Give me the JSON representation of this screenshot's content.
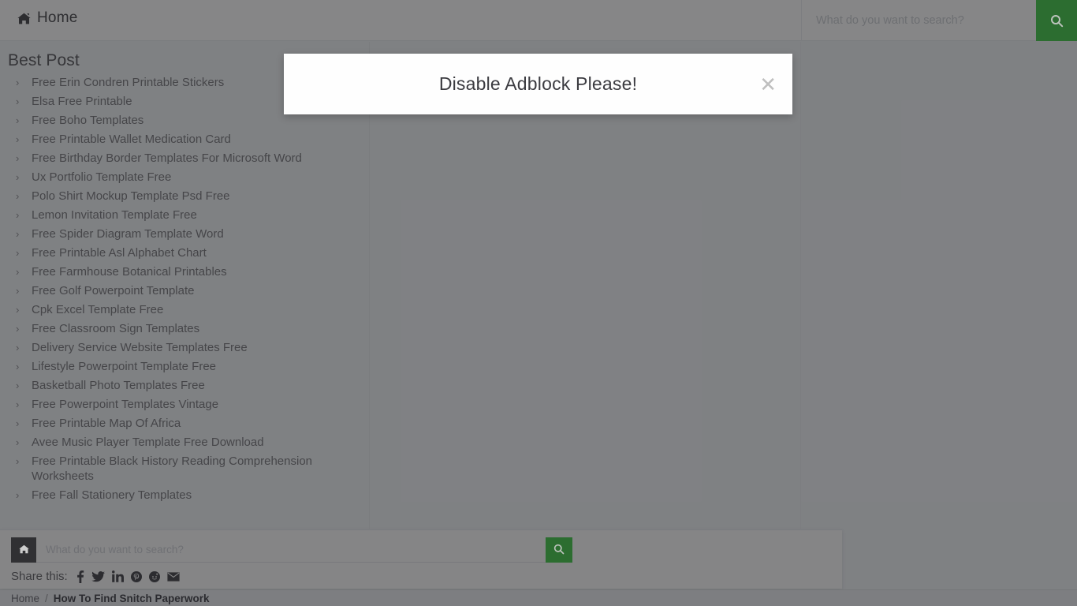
{
  "header": {
    "home_label": "Home",
    "home_icon": "house-icon",
    "search": {
      "placeholder": "What do you want to search?",
      "value": "",
      "button_icon": "search-icon",
      "button_color": "#2e7d32"
    }
  },
  "sidebar": {
    "title": "Best Post",
    "bullet": "›",
    "items": [
      "Free Erin Condren Printable Stickers",
      "Elsa Free Printable",
      "Free Boho Templates",
      "Free Printable Wallet Medication Card",
      "Free Birthday Border Templates For Microsoft Word",
      "Ux Portfolio Template Free",
      "Polo Shirt Mockup Template Psd Free",
      "Lemon Invitation Template Free",
      "Free Spider Diagram Template Word",
      "Free Printable Asl Alphabet Chart",
      "Free Farmhouse Botanical Printables",
      "Free Golf Powerpoint Template",
      "Cpk Excel Template Free",
      "Free Classroom Sign Templates",
      "Delivery Service Website Templates Free",
      "Lifestyle Powerpoint Template Free",
      "Basketball Photo Templates Free",
      "Free Powerpoint Templates Vintage",
      "Free Printable Map Of Africa",
      "Avee Music Player Template Free Download",
      "Free Printable Black History Reading Comprehension Worksheets",
      "Free Fall Stationery Templates"
    ]
  },
  "bottom_panel": {
    "home_button_icon": "house-icon",
    "search": {
      "placeholder": "What do you want to search?",
      "value": "",
      "button_icon": "search-icon",
      "button_color": "#2e7d32"
    },
    "share": {
      "label": "Share this:",
      "icons": [
        {
          "name": "facebook-icon",
          "title": "Facebook"
        },
        {
          "name": "twitter-icon",
          "title": "Twitter"
        },
        {
          "name": "linkedin-icon",
          "title": "LinkedIn"
        },
        {
          "name": "pinterest-icon",
          "title": "Pinterest"
        },
        {
          "name": "reddit-icon",
          "title": "Reddit"
        },
        {
          "name": "email-icon",
          "title": "Email"
        }
      ]
    }
  },
  "breadcrumb": {
    "home": "Home",
    "separator": "/",
    "current": "How To Find Snitch Paperwork"
  },
  "modal": {
    "title": "Disable Adblock Please!",
    "close_label": "✕",
    "close_icon": "close-icon"
  }
}
